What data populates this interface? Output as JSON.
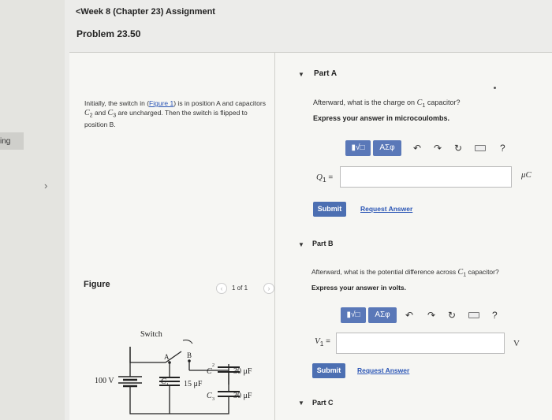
{
  "sidebar": {
    "fragment_text": "ing",
    "chevron": "›"
  },
  "header": {
    "back_link": "<Week 8 (Chapter 23) Assignment",
    "problem_title": "Problem 23.50"
  },
  "problem": {
    "text_1": "Initially, the switch in (",
    "figure_link": "Figure 1",
    "text_2": ") is in position A and capacitors ",
    "c2": "C",
    "c2_sub": "2",
    "text_3": " and ",
    "c3": "C",
    "c3_sub": "3",
    "text_4": " are uncharged. Then the switch is flipped to position B."
  },
  "figure": {
    "label": "Figure",
    "counter": "1 of 1",
    "prev": "‹",
    "next": "›",
    "circuit": {
      "switch_label": "Switch",
      "pos_a": "A",
      "pos_b": "B",
      "voltage": "100 V",
      "c1_label": "C",
      "c1_sub": "1",
      "c1_value": "15 μF",
      "c2_label": "C",
      "c2_sub": "2",
      "c2_value": "30 μF",
      "c3_label": "C",
      "c3_sub": "3",
      "c3_value": "30 μF"
    }
  },
  "partA": {
    "caret": "▼",
    "title": "Part A",
    "question_pre": "Afterward, what is the charge on ",
    "question_var": "C",
    "question_sub": "1",
    "question_post": " capacitor?",
    "instruction": "Express your answer in microcoulombs.",
    "var_label": "Q",
    "var_sub": "1",
    "equals": "=",
    "input_value": "",
    "unit": "μC",
    "submit": "Submit",
    "request": "Request Answer"
  },
  "partB": {
    "caret": "▼",
    "title": "Part B",
    "question_pre": "Afterward, what is the potential difference across ",
    "question_var": "C",
    "question_sub": "1",
    "question_post": " capacitor?",
    "instruction": "Express your answer in volts.",
    "var_label": "V",
    "var_sub": "1",
    "equals": "=",
    "input_value": "",
    "unit": "V",
    "submit": "Submit",
    "request": "Request Answer"
  },
  "partC": {
    "caret": "▼",
    "title": "Part C"
  },
  "toolbar": {
    "templates_label": "▮√□",
    "symbols_label": "ΑΣφ",
    "undo": "↶",
    "redo": "↷",
    "reset": "↻",
    "help": "?"
  },
  "colors": {
    "toolbar_button": "#5a78b8",
    "submit_button": "#4c6fb2",
    "link": "#2a55b5"
  }
}
